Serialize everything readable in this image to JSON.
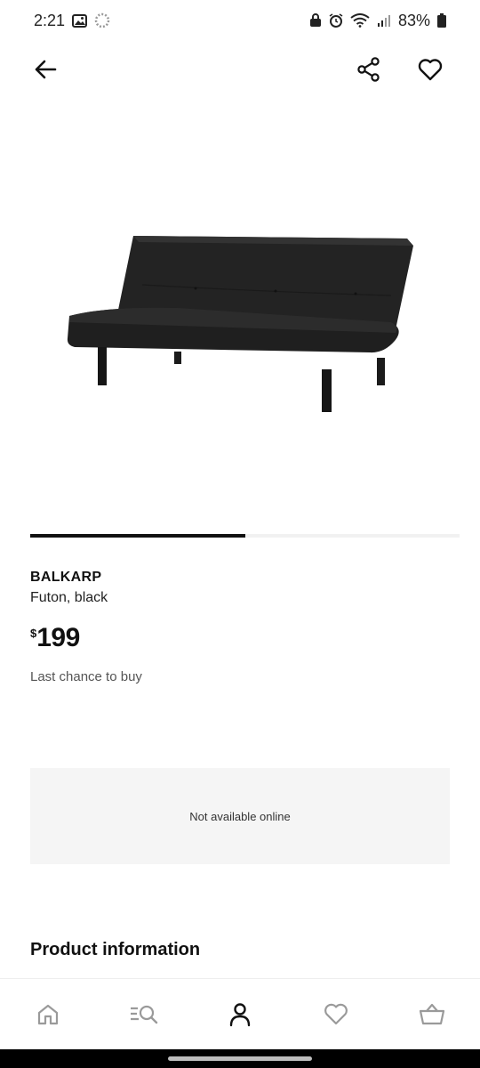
{
  "status_bar": {
    "time": "2:21",
    "battery": "83%",
    "icons": [
      "image-icon",
      "loading-icon",
      "lock-icon",
      "alarm-icon",
      "wifi-icon",
      "signal-icon",
      "battery-icon"
    ]
  },
  "top_bar": {
    "icons": [
      "back-arrow-icon",
      "share-icon",
      "heart-icon"
    ]
  },
  "carousel": {
    "progress": 0.5
  },
  "product": {
    "name": "BALKARP",
    "description": "Futon, black",
    "price_currency": "$",
    "price_value": "199",
    "availability_note": "Last chance to buy"
  },
  "availability_box": {
    "text": "Not available online"
  },
  "sections": {
    "product_info_title": "Product information"
  },
  "bottom_nav": {
    "items": [
      "home-icon",
      "search-icon",
      "account-icon",
      "favorites-icon",
      "cart-icon"
    ],
    "active": "account-icon"
  },
  "colors": {
    "text": "#111111",
    "muted": "#555555",
    "panel": "#f5f5f5",
    "accent": "#111111"
  }
}
